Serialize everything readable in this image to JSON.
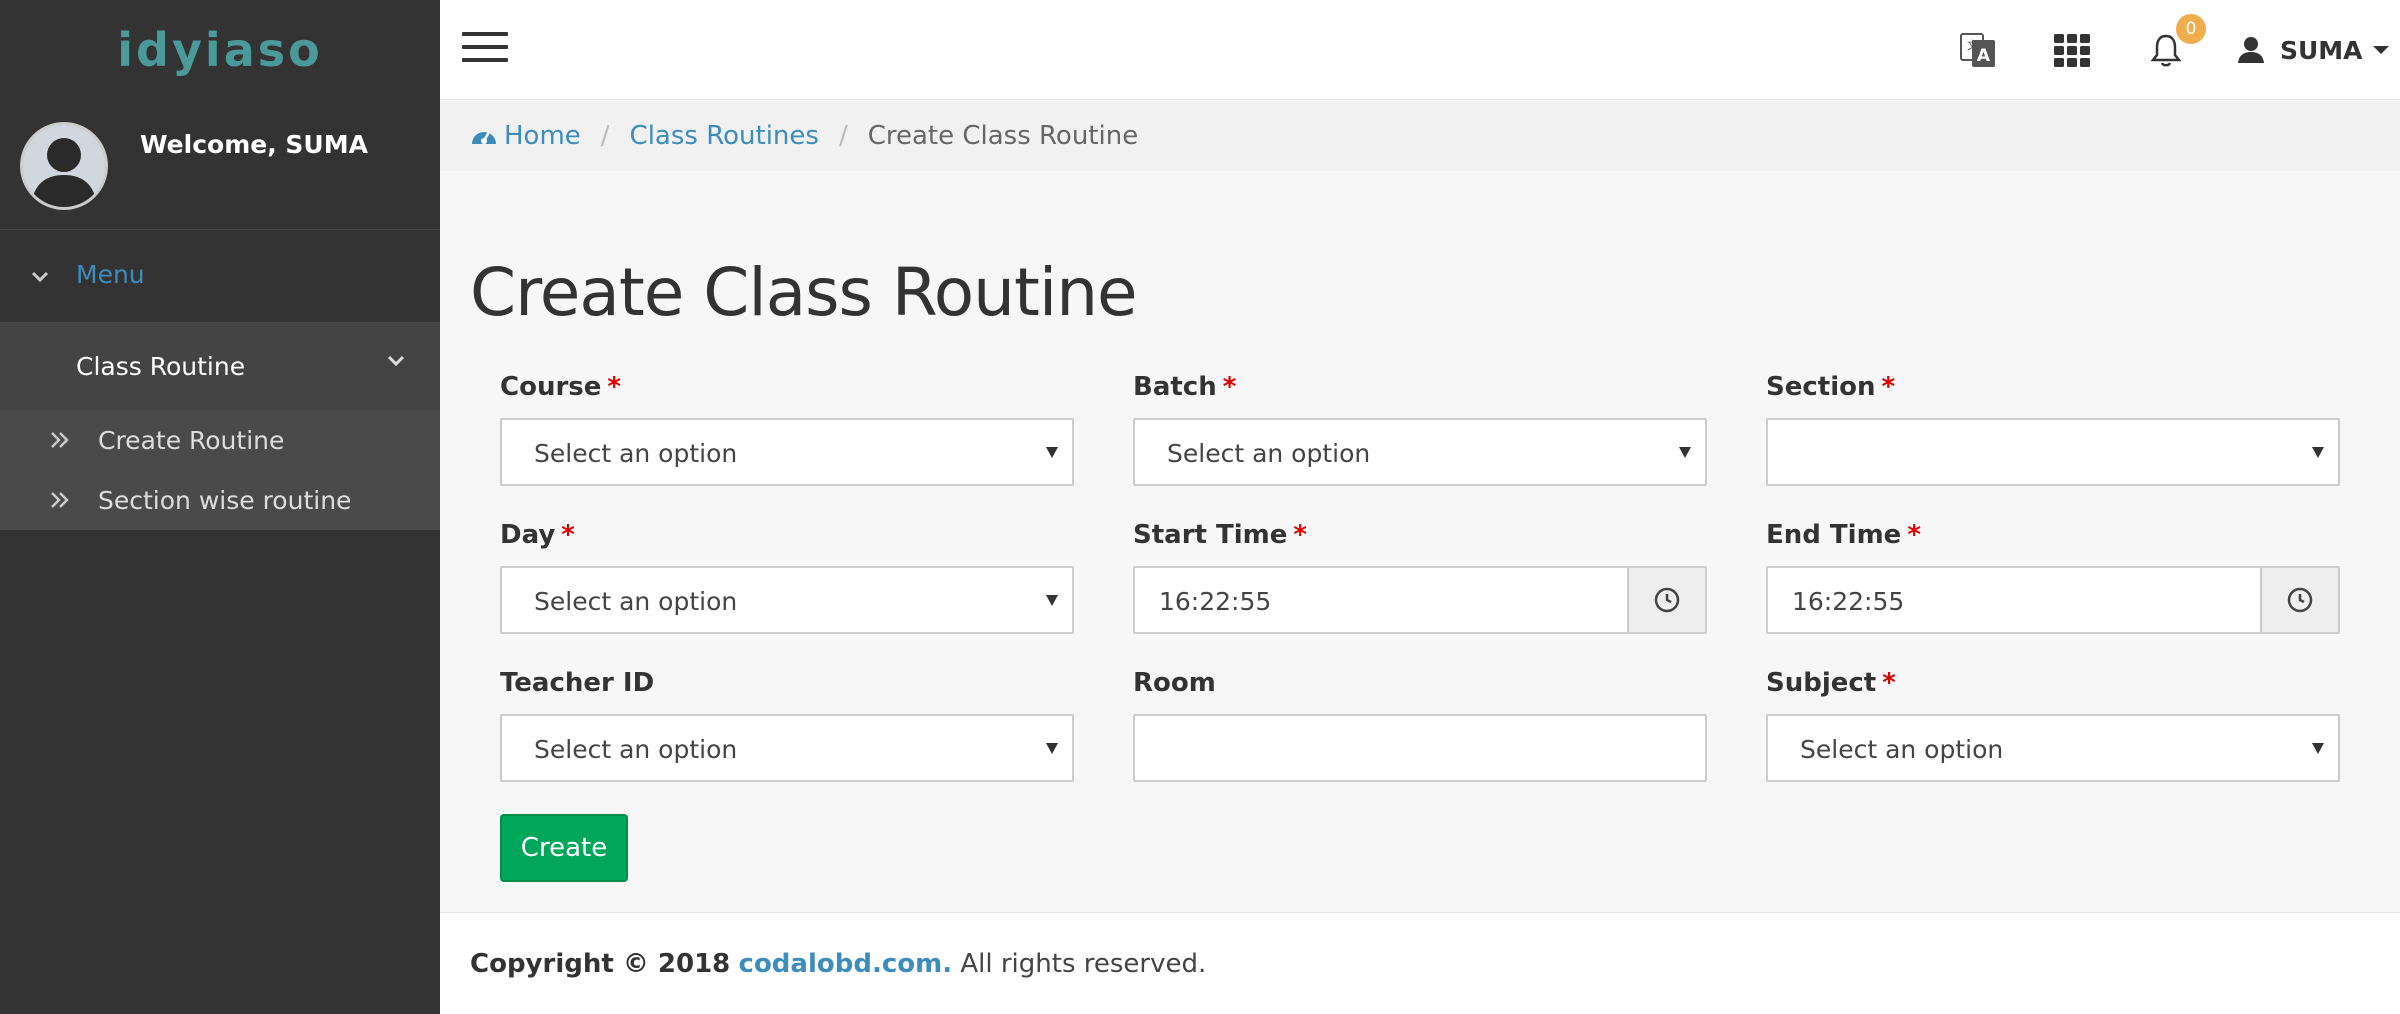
{
  "sidebar": {
    "logo_text": "idyiaso",
    "welcome": "Welcome, SUMA",
    "menu_label": "Menu",
    "group_label": "Class Routine",
    "items": [
      {
        "label": "Create Routine"
      },
      {
        "label": "Section wise routine"
      }
    ]
  },
  "topbar": {
    "notification_count": "0",
    "user_name": "SUMA"
  },
  "breadcrumb": {
    "home": "Home",
    "parent": "Class Routines",
    "current": "Create Class Routine"
  },
  "page": {
    "title": "Create Class Routine"
  },
  "form": {
    "course": {
      "label": "Course",
      "required": "*",
      "value": "Select an option"
    },
    "batch": {
      "label": "Batch",
      "required": "*",
      "value": "Select an option"
    },
    "section": {
      "label": "Section",
      "required": "*",
      "value": ""
    },
    "day": {
      "label": "Day",
      "required": "*",
      "value": "Select an option"
    },
    "start_time": {
      "label": "Start Time",
      "required": "*",
      "value": "16:22:55"
    },
    "end_time": {
      "label": "End Time",
      "required": "*",
      "value": "16:22:55"
    },
    "teacher_id": {
      "label": "Teacher ID",
      "value": "Select an option"
    },
    "room": {
      "label": "Room",
      "value": ""
    },
    "subject": {
      "label": "Subject",
      "required": "*",
      "value": "Select an option"
    },
    "submit_label": "Create"
  },
  "footer": {
    "prefix": "Copyright © 2018",
    "link": "codalobd.com.",
    "suffix": "All rights reserved."
  },
  "colors": {
    "sidebar_bg": "#333333",
    "accent_blue": "#3c8dbc",
    "create_green": "#00a65a",
    "badge_orange": "#f0ad4e",
    "required_red": "#dd0000"
  }
}
